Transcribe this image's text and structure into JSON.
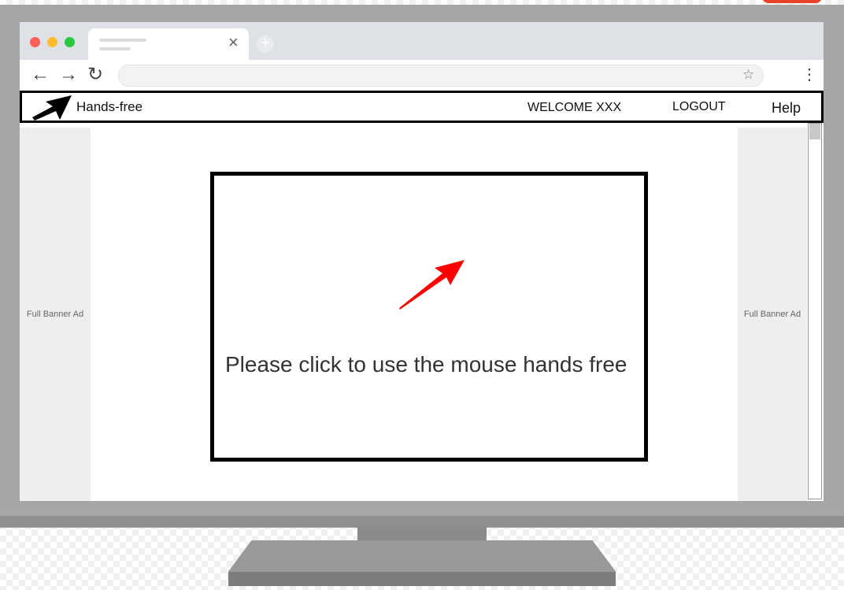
{
  "browser": {
    "tab_close_glyph": "×",
    "new_tab_glyph": "+",
    "back_glyph": "←",
    "forward_glyph": "→",
    "reload_glyph": "↻",
    "star_glyph": "☆",
    "menu_glyph": "⋮"
  },
  "header": {
    "app_name": "Hands-free",
    "welcome": "WELCOME XXX",
    "logout": "LOGOUT",
    "help": "Help"
  },
  "ads": {
    "left": "Full Banner Ad",
    "right": "Full Banner Ad"
  },
  "main": {
    "prompt": "Please click to use the mouse hands free"
  },
  "icons": {
    "logo": "arrow-cursor-icon",
    "pointer": "red-arrow-icon"
  },
  "colors": {
    "pointer_arrow": "#ff0000",
    "logo_arrow": "#000000"
  }
}
